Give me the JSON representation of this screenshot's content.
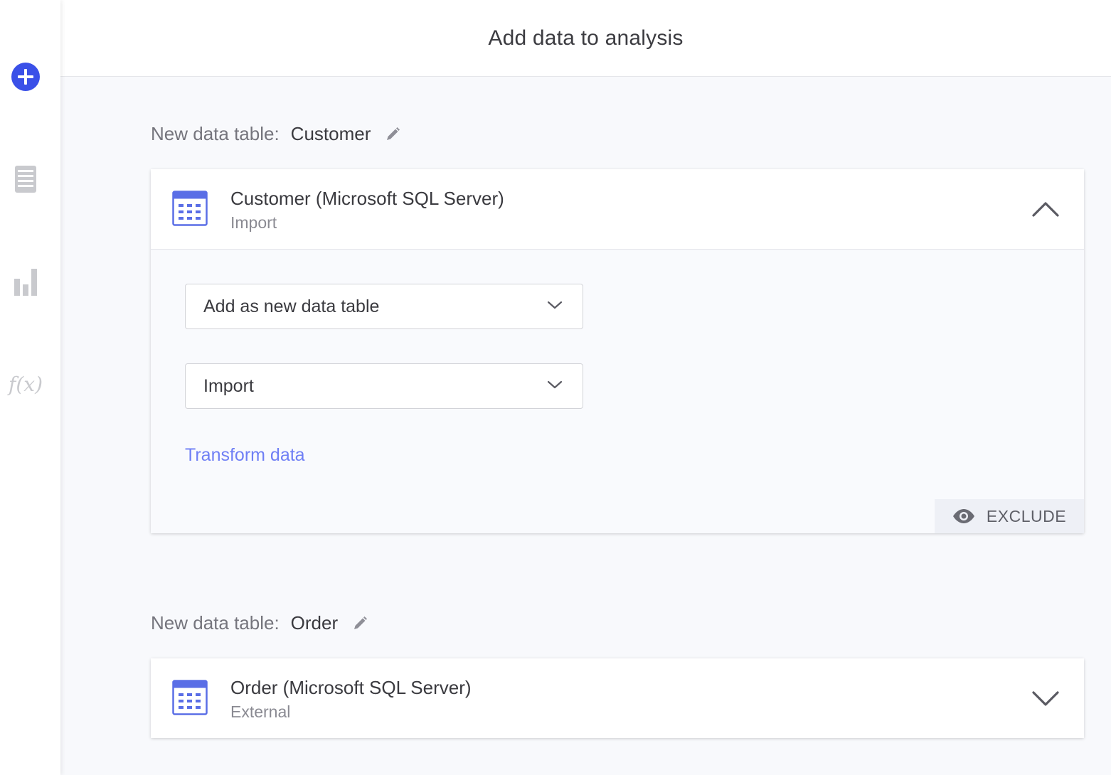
{
  "header": {
    "title": "Add data to analysis"
  },
  "sidebar": {
    "items": [
      {
        "name": "add",
        "icon": "plus-circle-icon",
        "color": "#3a50e8"
      },
      {
        "name": "data",
        "icon": "data-table-icon"
      },
      {
        "name": "visualizations",
        "icon": "bar-chart-icon"
      },
      {
        "name": "expression",
        "icon": "function-icon",
        "glyph": "f(x)"
      }
    ]
  },
  "tables": [
    {
      "label": "New data table:",
      "name": "Customer",
      "source_name": "Customer (Microsoft SQL Server)",
      "source_mode": "Import",
      "expanded": true,
      "add_mode": "Add as new data table",
      "load_mode": "Import",
      "transform_link": "Transform data",
      "exclude_label": "EXCLUDE"
    },
    {
      "label": "New data table:",
      "name": "Order",
      "source_name": "Order (Microsoft SQL Server)",
      "source_mode": "External",
      "expanded": false
    }
  ],
  "colors": {
    "accent": "#3a50e8",
    "link": "#6f7ff5",
    "icon_blue": "#5a6ee6"
  }
}
